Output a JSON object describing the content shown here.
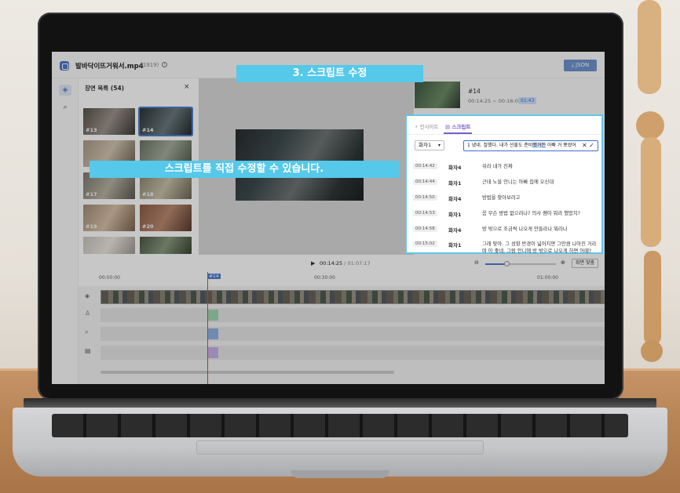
{
  "header": {
    "filename": "발바닥이뜨거워서.mp4",
    "count": "(1919)",
    "info_icon": "info-icon",
    "json_label": "JSON"
  },
  "scenes": {
    "title": "장면 목록 (54)",
    "close": "×",
    "thumbs": [
      {
        "label": "#13"
      },
      {
        "label": "#14"
      },
      {
        "label": "#17"
      },
      {
        "label": "#18"
      },
      {
        "label": "#19"
      },
      {
        "label": "#20"
      }
    ]
  },
  "detail": {
    "id": "#14",
    "time": "00:14:25 ~ 00:16:09",
    "duration": "01:43"
  },
  "panel": {
    "tab_insight": "인사이트",
    "tab_script": "스크립트",
    "speaker": "화자1",
    "edit_text_pre": "1 냈네. 잘했다. 내가 선물도 준비",
    "edit_text_hl": "했거든",
    "edit_text_post": " 아빠 거 뽀썼어",
    "rows": [
      {
        "ts": "00:14:42",
        "speaker": "화자4",
        "text": "쉬라 내가 진짜"
      },
      {
        "ts": "00:14:44",
        "speaker": "화자1",
        "text": "근데 노을 언니는 아빠 집에 오신대"
      },
      {
        "ts": "00:14:50",
        "speaker": "화자4",
        "text": "방법을 찾아보려고"
      },
      {
        "ts": "00:14:53",
        "speaker": "화자1",
        "text": "음 무슨 방법 없으려나? 의사 쌤이 뭐라 했었지?"
      },
      {
        "ts": "00:14:58",
        "speaker": "화자4",
        "text": "방 밖으로 조금씩 나오게 만들라나 뭐라나"
      },
      {
        "ts": "00:15:02",
        "speaker": "화자1",
        "text": "그래 맞아. 그 성향 반경이 넓어지면 그만큼 나아진 거라며 아 좋네. 그럼 언니에 방 밖으로 나오게 하면 어때?"
      }
    ]
  },
  "timeline": {
    "current": "00:14:25",
    "total": "/ 01:07:17",
    "fit_label": "화면 맞춤",
    "ticks": [
      "00:00:00",
      "00:30:00",
      "01:00:00"
    ],
    "playhead_tag": "#14",
    "zoom_level": 0.3
  },
  "overlays": {
    "step_title": "3. 스크립트 수정",
    "caption": "스크립트를 직접 수정할 수 있습니다."
  },
  "colors": {
    "accent": "#56c8ea",
    "brand": "#4e7fd0",
    "script_tab": "#7a5cc8"
  }
}
